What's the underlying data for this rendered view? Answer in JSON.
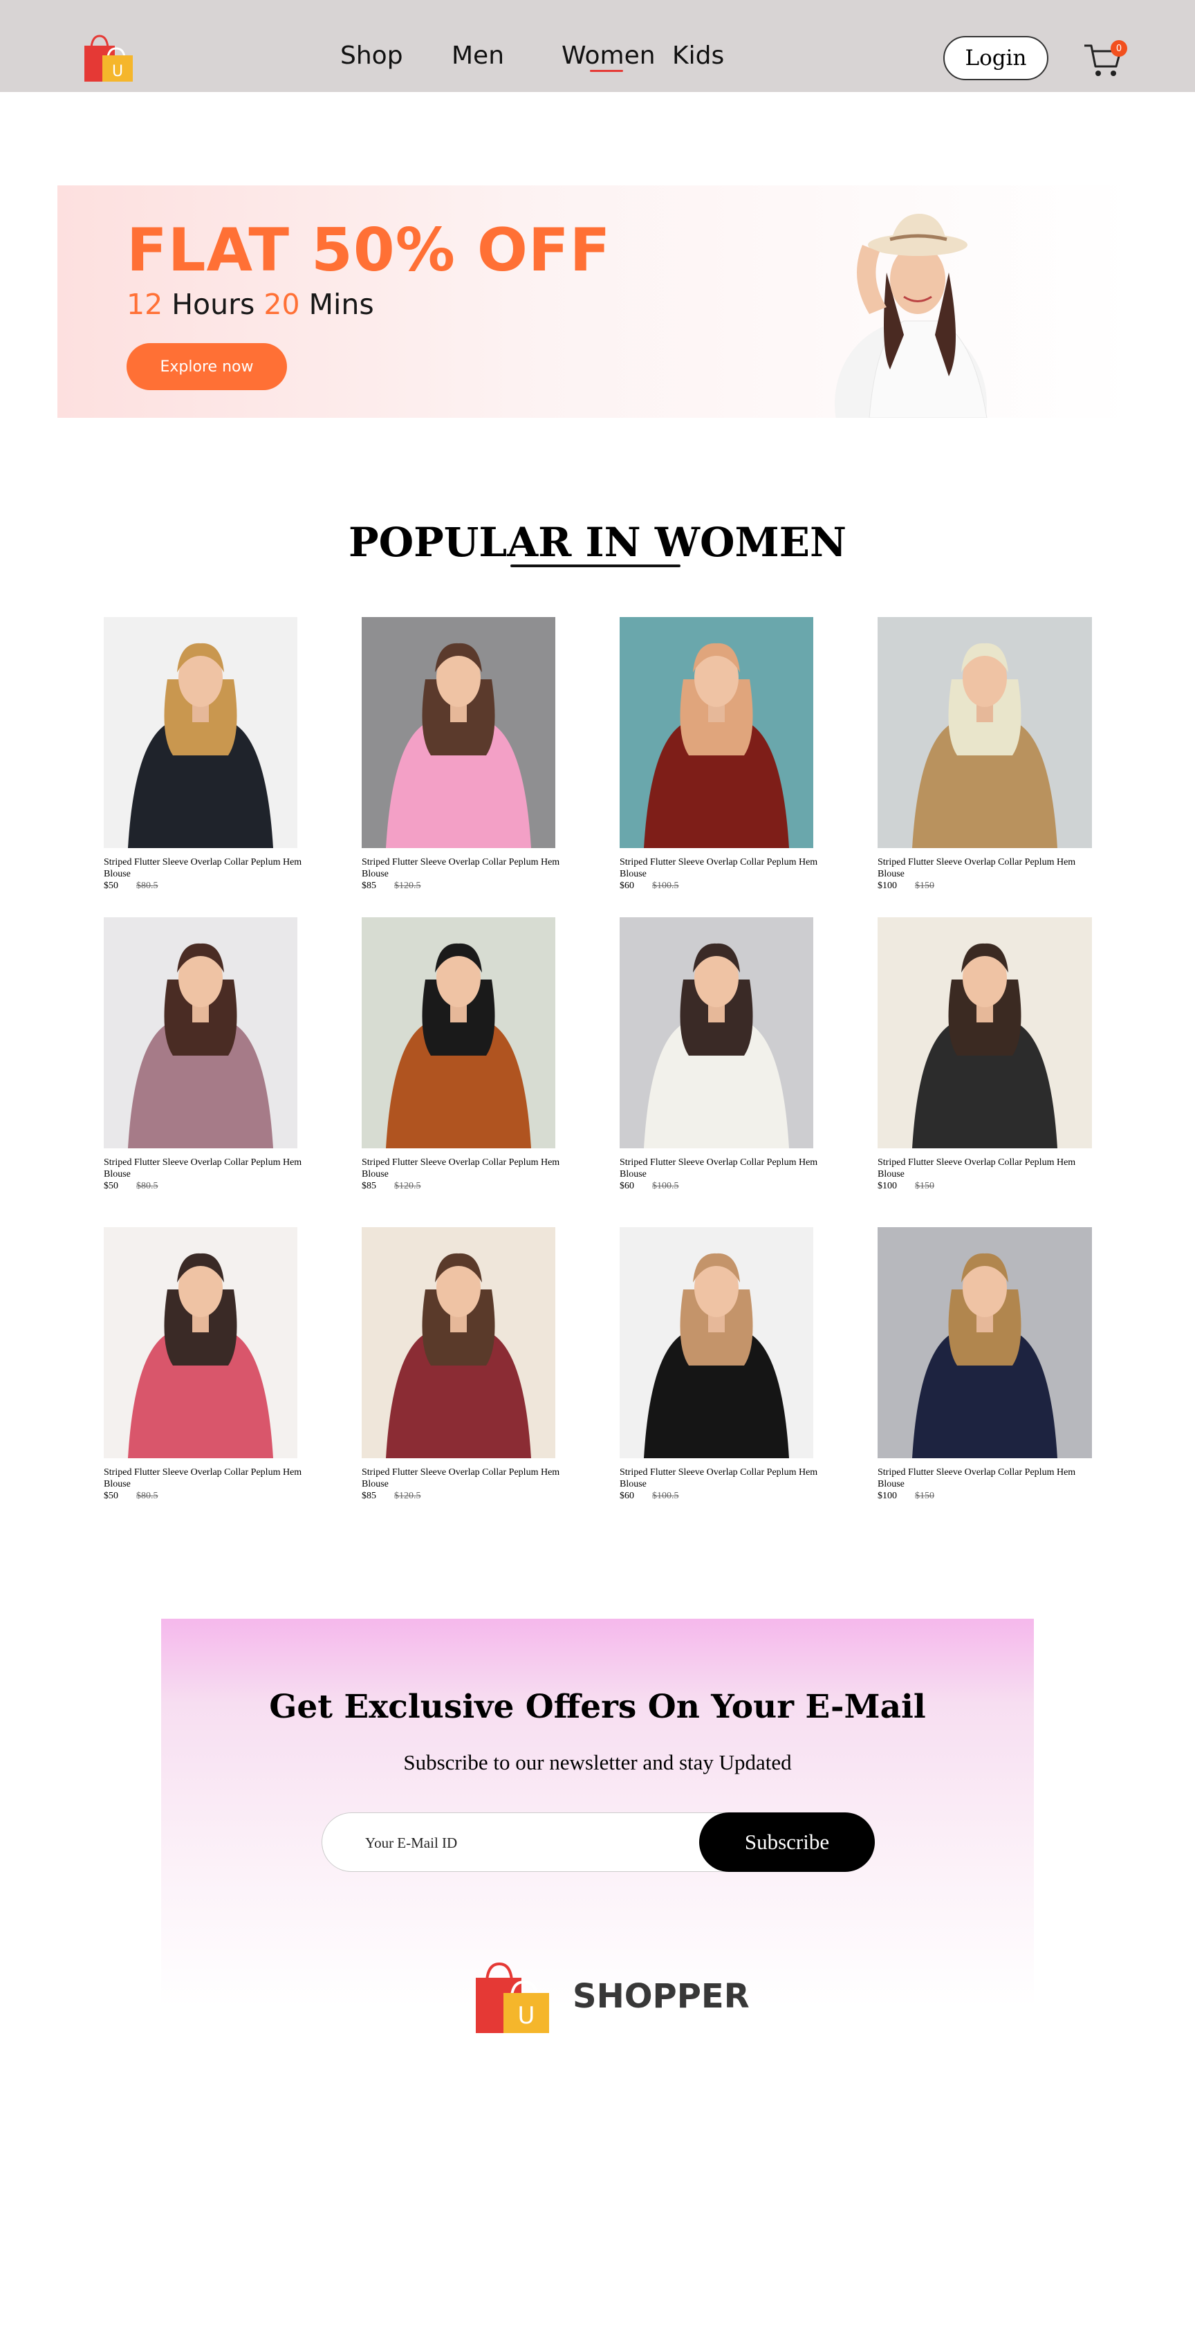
{
  "nav": {
    "items": [
      "Shop",
      "Men",
      "Women",
      "Kids"
    ],
    "active": "Women",
    "login_label": "Login",
    "cart_count": "0"
  },
  "hero": {
    "title": "FLAT 50% OFF",
    "hours_num": "12",
    "hours_label": " Hours ",
    "mins_num": "20",
    "mins_label": " Mins",
    "cta_label": "Explore now",
    "accent_color": "#ff7035"
  },
  "popular": {
    "title": "POPULAR IN WOMEN",
    "products": [
      {
        "name": "Striped Flutter Sleeve Overlap Collar Peplum Hem Blouse",
        "price": "$50",
        "old_price": "$80.5",
        "image": "woman-black-fur-jacket"
      },
      {
        "name": "Striped Flutter Sleeve Overlap Collar Peplum Hem Blouse",
        "price": "$85",
        "old_price": "$120.5",
        "image": "woman-pink-top"
      },
      {
        "name": "Striped Flutter Sleeve Overlap Collar Peplum Hem Blouse",
        "price": "$60",
        "old_price": "$100.5",
        "image": "woman-red-check-blouse"
      },
      {
        "name": "Striped Flutter Sleeve Overlap Collar Peplum Hem Blouse",
        "price": "$100",
        "old_price": "$150",
        "image": "woman-colorblock-crop-top"
      },
      {
        "name": "Striped Flutter Sleeve Overlap Collar Peplum Hem Blouse",
        "price": "$50",
        "old_price": "$80.5",
        "image": "woman-mauve-blouse"
      },
      {
        "name": "Striped Flutter Sleeve Overlap Collar Peplum Hem Blouse",
        "price": "$85",
        "old_price": "$120.5",
        "image": "woman-rust-hijab"
      },
      {
        "name": "Striped Flutter Sleeve Overlap Collar Peplum Hem Blouse",
        "price": "$60",
        "old_price": "$100.5",
        "image": "woman-white-turtleneck"
      },
      {
        "name": "Striped Flutter Sleeve Overlap Collar Peplum Hem Blouse",
        "price": "$100",
        "old_price": "$150",
        "image": "woman-floral-blouse"
      },
      {
        "name": "Striped Flutter Sleeve Overlap Collar Peplum Hem Blouse",
        "price": "$50",
        "old_price": "$80.5",
        "image": "woman-pink-floral-dress"
      },
      {
        "name": "Striped Flutter Sleeve Overlap Collar Peplum Hem Blouse",
        "price": "$85",
        "old_price": "$120.5",
        "image": "woman-maroon-hoodie"
      },
      {
        "name": "Striped Flutter Sleeve Overlap Collar Peplum Hem Blouse",
        "price": "$60",
        "old_price": "$100.5",
        "image": "woman-black-crop-top"
      },
      {
        "name": "Striped Flutter Sleeve Overlap Collar Peplum Hem Blouse",
        "price": "$100",
        "old_price": "$150",
        "image": "woman-navy-sweater"
      }
    ]
  },
  "newsletter": {
    "title": "Get Exclusive Offers On Your E-Mail",
    "subtitle": "Subscribe to our newsletter and stay Updated",
    "placeholder": "Your E-Mail ID",
    "button_label": "Subscribe"
  },
  "footer": {
    "brand": "SHOPPER",
    "logo_letter": "U"
  }
}
